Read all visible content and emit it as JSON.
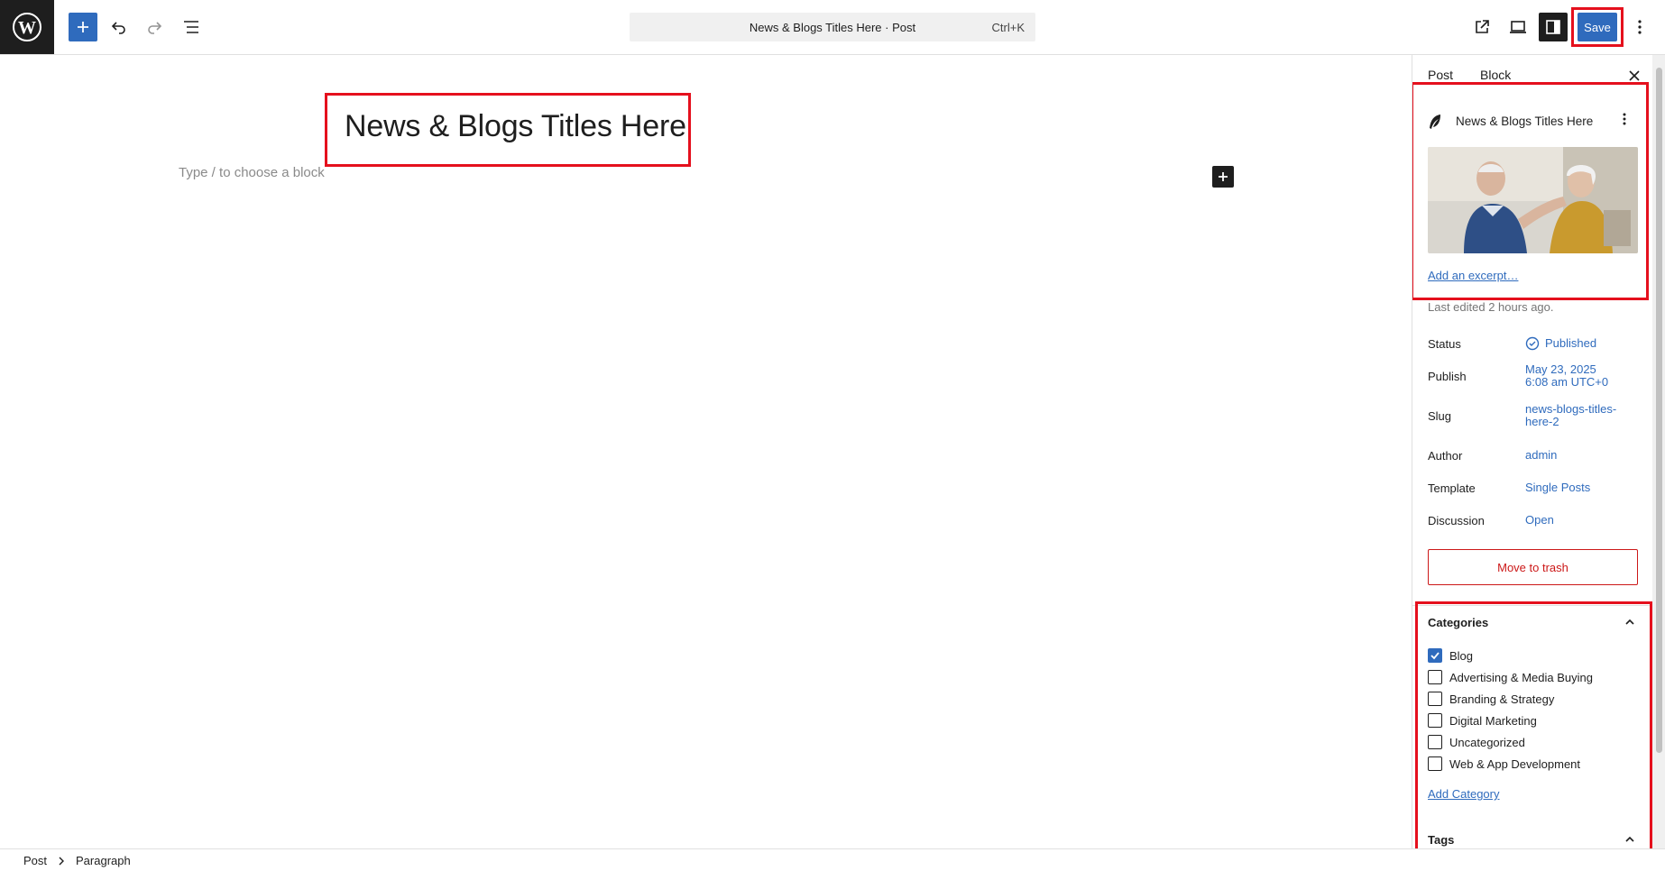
{
  "topbar": {
    "command_title": "News & Blogs Titles Here · Post",
    "command_shortcut": "Ctrl+K",
    "save_label": "Save",
    "accent": "#2f6bbd"
  },
  "editor": {
    "post_title": "News & Blogs Titles Here",
    "block_placeholder": "Type / to choose a block"
  },
  "sidebar": {
    "tabs": [
      {
        "label": "Post"
      },
      {
        "label": "Block"
      }
    ],
    "summary": {
      "title": "News & Blogs Titles Here",
      "excerpt_link": "Add an excerpt…",
      "last_edited": "Last edited 2 hours ago."
    },
    "meta": {
      "status_label": "Status",
      "status_value": "Published",
      "publish_label": "Publish",
      "publish_date": "May 23, 2025",
      "publish_time": "6:08 am UTC+0",
      "slug_label": "Slug",
      "slug_line1": "news-blogs-titles-",
      "slug_line2": "here-2",
      "author_label": "Author",
      "author_value": "admin",
      "template_label": "Template",
      "template_value": "Single Posts",
      "discussion_label": "Discussion",
      "discussion_value": "Open"
    },
    "trash_label": "Move to trash",
    "categories": {
      "heading": "Categories",
      "items": [
        {
          "label": "Blog",
          "checked": true
        },
        {
          "label": "Advertising & Media Buying",
          "checked": false
        },
        {
          "label": "Branding & Strategy",
          "checked": false
        },
        {
          "label": "Digital Marketing",
          "checked": false
        },
        {
          "label": "Uncategorized",
          "checked": false
        },
        {
          "label": "Web & App Development",
          "checked": false
        }
      ],
      "add_link": "Add Category"
    },
    "tags_heading": "Tags"
  },
  "footer": {
    "breadcrumbs": [
      "Post",
      "Paragraph"
    ]
  },
  "icons": [
    "wordpress-logo-icon",
    "plus-icon",
    "undo-icon",
    "redo-icon",
    "list-view-icon",
    "external-link-icon",
    "device-preview-icon",
    "sidebar-toggle-icon",
    "more-options-icon",
    "close-icon",
    "feather-icon",
    "check-circle-icon",
    "chevron-up-icon",
    "chevron-right-icon"
  ]
}
